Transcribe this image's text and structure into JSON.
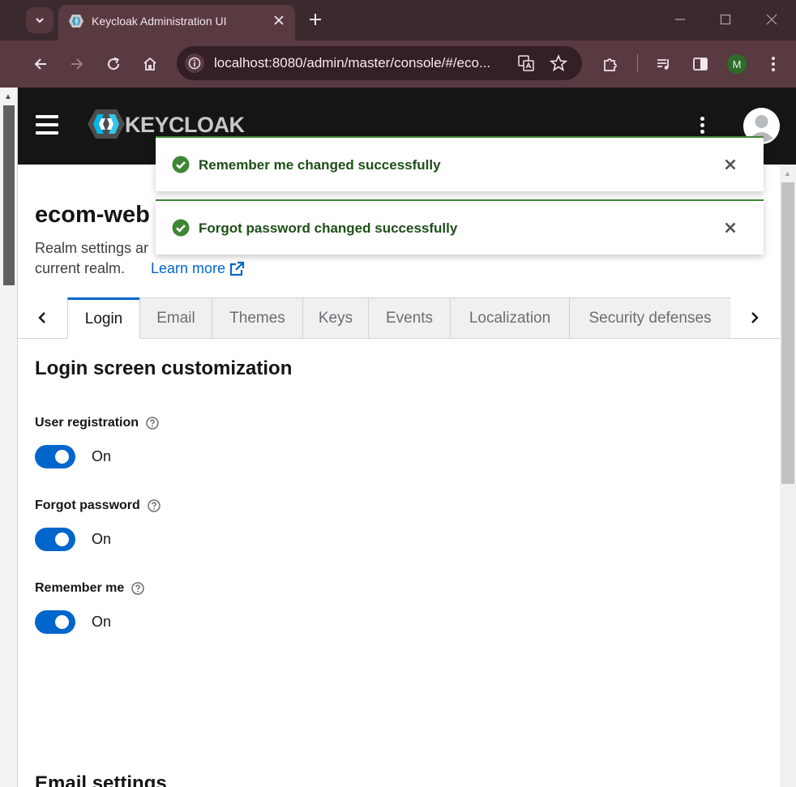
{
  "browser": {
    "tab_title": "Keycloak Administration UI",
    "url": "localhost:8080/admin/master/console/#/eco...",
    "profile_initial": "M"
  },
  "header": {
    "logo_text": "KEYCLOAK"
  },
  "page": {
    "realm_title": "ecom-web",
    "description_line1": "Realm settings ar",
    "description_line2": "current realm.",
    "learn_more": "Learn more"
  },
  "tabs": [
    {
      "label": "Login",
      "active": true
    },
    {
      "label": "Email"
    },
    {
      "label": "Themes"
    },
    {
      "label": "Keys"
    },
    {
      "label": "Events"
    },
    {
      "label": "Localization"
    },
    {
      "label": "Security defenses"
    }
  ],
  "login": {
    "section_title": "Login screen customization",
    "fields": [
      {
        "label": "User registration",
        "state": "On",
        "enabled": true
      },
      {
        "label": "Forgot password",
        "state": "On",
        "enabled": true
      },
      {
        "label": "Remember me",
        "state": "On",
        "enabled": true
      }
    ],
    "next_section_title": "Email settings"
  },
  "alerts": [
    {
      "message": "Remember me changed successfully"
    },
    {
      "message": "Forgot password changed successfully"
    }
  ],
  "colors": {
    "accent": "#0066cc",
    "success": "#3e8635",
    "header_bg": "#151515"
  }
}
